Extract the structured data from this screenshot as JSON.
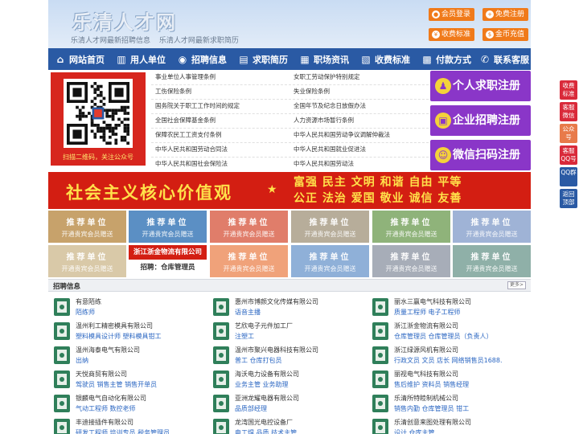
{
  "site": {
    "title": "乐清人才网",
    "subtitle_1": "乐清人才网最新招聘信息",
    "subtitle_2": "乐清人才网最新求职简历"
  },
  "header_buttons": {
    "login": "会员登录",
    "register": "免费注册",
    "fees": "收费标准",
    "recharge": "金币充值"
  },
  "nav": [
    {
      "label": "网站首页",
      "icon": "home-icon",
      "glyph": "⌂"
    },
    {
      "label": "用人单位",
      "icon": "building-icon",
      "glyph": "▥"
    },
    {
      "label": "招聘信息",
      "icon": "person-icon",
      "glyph": "◉"
    },
    {
      "label": "求职简历",
      "icon": "document-icon",
      "glyph": "▤"
    },
    {
      "label": "职场资讯",
      "icon": "news-icon",
      "glyph": "▦"
    },
    {
      "label": "收费标准",
      "icon": "list-icon",
      "glyph": "▧"
    },
    {
      "label": "付款方式",
      "icon": "wallet-icon",
      "glyph": "▩"
    },
    {
      "label": "联系客服",
      "icon": "phone-icon",
      "glyph": "✆"
    }
  ],
  "qr": {
    "caption": "扫描二维码，关注公众号"
  },
  "policy_links": {
    "left": [
      "事业单位人事管理条例",
      "工伤保险条例",
      "国务院关于职工工作时间的规定",
      "全国社会保障基金条例",
      "保障农民工工资支付条例",
      "中华人民共和国劳动合同法",
      "中华人民共和国社会保险法"
    ],
    "right": [
      "女职工劳动保护特别规定",
      "失业保险条例",
      "全国年节及纪念日放假办法",
      "人力资源市场暂行条例",
      "中华人民共和国劳动争议调解仲裁法",
      "中华人民共和国就业促进法",
      "中华人民共和国劳动法"
    ]
  },
  "register": {
    "job_seeker": "个人求职注册",
    "employer": "企业招聘注册",
    "wechat": "微信扫码注册"
  },
  "banner": {
    "main": "社会主义核心价值观",
    "line1": "富强  民主  文明  和谐  自由  平等",
    "line2": "公正  法治  爱国  敬业  诚信  友善"
  },
  "recommend": {
    "title": "推荐单位",
    "note": "开通贵宾会员赠送",
    "row1_colors": [
      "#c7a26b",
      "#5b8fc4",
      "#e07d6a",
      "#b7ad9a",
      "#8fb37a",
      "#9fb3d6"
    ],
    "row2_colors": [
      "#d9c9a8",
      null,
      "#f0a27a",
      "#8fb0d8",
      "#a7adb8",
      "#8fb0a8"
    ],
    "company_name": "浙江浙金物流有限公司",
    "company_job": "招聘：仓库管理员"
  },
  "jobs": {
    "title": "招聘信息",
    "more": "更多>",
    "items": [
      {
        "company": "有意陌练",
        "positions": "陌练师"
      },
      {
        "company": "惠州市博颜文化传媒有限公司",
        "positions": "语音主播"
      },
      {
        "company": "丽水三赢电气科技有限公司",
        "positions": "质量工程师 电子工程师"
      },
      {
        "company": "温州利工精密模具有限公司",
        "positions": "塑料模具设计师 塑料模具钳工"
      },
      {
        "company": "艺欣电子元件加工厂",
        "positions": "注塑工"
      },
      {
        "company": "浙江浙金物流有限公司",
        "positions": "仓库管理员 仓库管理员（负责人）"
      },
      {
        "company": "温州海泰电气有限公司",
        "positions": "出纳"
      },
      {
        "company": "温州市聚兴电器科技有限公司",
        "positions": "普工 仓库打包员"
      },
      {
        "company": "浙江绿源风机有限公司",
        "positions": "行政文员 文员 店长 网络销售员1688."
      },
      {
        "company": "天悦商贸有限公司",
        "positions": "驾驶员 销售主管 销售开单员"
      },
      {
        "company": "海沃电力设备有限公司",
        "positions": "业务主管 业务助理"
      },
      {
        "company": "丽视电气科技有限公司",
        "positions": "售后维护 资料员 销售经理"
      },
      {
        "company": "银麟电气自动化有限公司",
        "positions": "气动工程师 数控老师"
      },
      {
        "company": "亚洲龙耀电器有限公司",
        "positions": "品质部经理"
      },
      {
        "company": "乐清所特睦制机械公司",
        "positions": "销售内勤 仓库管理员 钳工"
      },
      {
        "company": "丰迪接插件有限公司",
        "positions": "研发工程师 培训专员 税务管理员"
      },
      {
        "company": "龙湾国光电控设备厂",
        "positions": "电工焊 品质 技术主管"
      },
      {
        "company": "乐清创意来图处理有限公司",
        "positions": "设计 仓库主管"
      }
    ]
  },
  "float_bar": [
    {
      "label": "收费标准",
      "color": "#d92a3a"
    },
    {
      "label": "客服微信",
      "color": "#d92a3a"
    },
    {
      "label": "公众号",
      "color": "#e87a4a"
    },
    {
      "label": "客服QQ号",
      "color": "#d92a3a"
    },
    {
      "label": "QQ群",
      "color": "#2a5aa4"
    },
    {
      "label": "返回顶部",
      "color": "#2a5aa4"
    }
  ]
}
